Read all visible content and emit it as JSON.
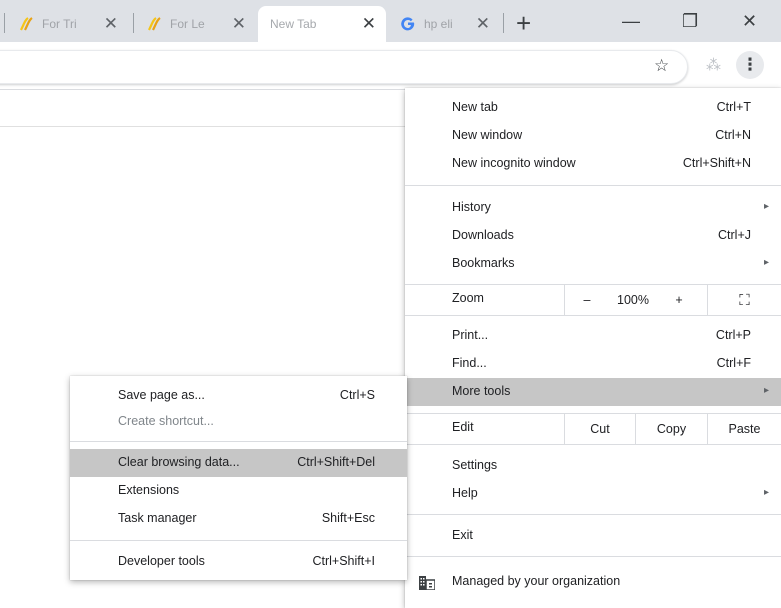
{
  "tabs": [
    {
      "title": "For Tri",
      "favicon": "sheets-swirl-icon",
      "active": false
    },
    {
      "title": "For Le",
      "favicon": "sheets-swirl-icon",
      "active": false
    },
    {
      "title": "New Tab",
      "favicon": "",
      "active": true
    },
    {
      "title": "hp eli",
      "favicon": "google-g-icon",
      "active": false
    }
  ],
  "tab_close_glyph": "✕",
  "new_tab_glyph": "+",
  "window": {
    "minimize": "—",
    "restore": "❐",
    "close": "✕"
  },
  "toolbar": {
    "star": "☆",
    "menu": "⋮",
    "extension": "⁂"
  },
  "menu": {
    "new_tab": {
      "label": "New tab",
      "shortcut": "Ctrl+T"
    },
    "new_window": {
      "label": "New window",
      "shortcut": "Ctrl+N"
    },
    "new_incognito": {
      "label": "New incognito window",
      "shortcut": "Ctrl+Shift+N"
    },
    "history": {
      "label": "History"
    },
    "downloads": {
      "label": "Downloads",
      "shortcut": "Ctrl+J"
    },
    "bookmarks": {
      "label": "Bookmarks"
    },
    "zoom": {
      "label": "Zoom",
      "minus": "–",
      "level": "100%",
      "plus": "+",
      "fullscreen": "⛶"
    },
    "print": {
      "label": "Print...",
      "shortcut": "Ctrl+P"
    },
    "find": {
      "label": "Find...",
      "shortcut": "Ctrl+F"
    },
    "more_tools": {
      "label": "More tools"
    },
    "edit": {
      "label": "Edit",
      "cut": "Cut",
      "copy": "Copy",
      "paste": "Paste"
    },
    "settings": {
      "label": "Settings"
    },
    "help": {
      "label": "Help"
    },
    "exit": {
      "label": "Exit"
    },
    "managed": {
      "label": "Managed by your organization"
    },
    "arrow": "▸"
  },
  "submenu": {
    "save_page": {
      "label": "Save page as...",
      "shortcut": "Ctrl+S"
    },
    "create_shortcut": {
      "label": "Create shortcut..."
    },
    "clear_browsing": {
      "label": "Clear browsing data...",
      "shortcut": "Ctrl+Shift+Del"
    },
    "extensions": {
      "label": "Extensions"
    },
    "task_manager": {
      "label": "Task manager",
      "shortcut": "Shift+Esc"
    },
    "developer_tools": {
      "label": "Developer tools",
      "shortcut": "Ctrl+Shift+I"
    }
  },
  "colors": {
    "tabstrip": "#dee1e6",
    "highlight": "#c6c6c6",
    "sheets_yellow": "#f5c518",
    "google_blue": "#4285f4"
  }
}
